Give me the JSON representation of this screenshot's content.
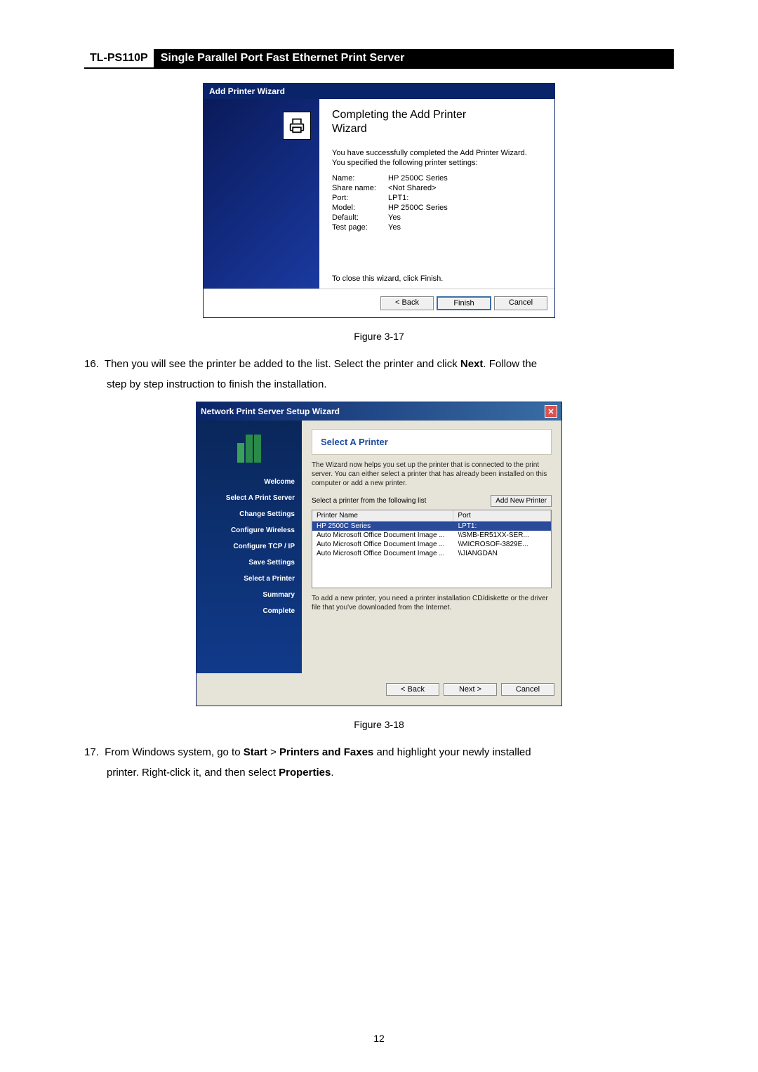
{
  "header": {
    "model": "TL-PS110P",
    "product": "Single Parallel Port Fast Ethernet Print Server"
  },
  "wizard1": {
    "title": "Add Printer Wizard",
    "heading1": "Completing the Add Printer",
    "heading2": "Wizard",
    "desc1": "You have successfully completed the Add Printer Wizard.",
    "desc2": "You specified the following printer settings:",
    "rows": {
      "name_k": "Name:",
      "name_v": "HP 2500C Series",
      "share_k": "Share name:",
      "share_v": "<Not Shared>",
      "port_k": "Port:",
      "port_v": "LPT1:",
      "model_k": "Model:",
      "model_v": "HP 2500C Series",
      "default_k": "Default:",
      "default_v": "Yes",
      "test_k": "Test page:",
      "test_v": "Yes"
    },
    "close_note": "To close this wizard, click Finish.",
    "back": "< Back",
    "finish": "Finish",
    "cancel": "Cancel"
  },
  "fig1": "Figure 3-17",
  "step16a": "16.  Then you will see the printer be added to the list. Select the printer and click ",
  "next_bold": "Next",
  "step16b": ". Follow the",
  "step16c": "step by step instruction to finish the installation.",
  "wizard2": {
    "title": "Network Print Server Setup Wizard",
    "side": {
      "i0": "Welcome",
      "i1": "Select A Print Server",
      "i2": "Change Settings",
      "i3": "Configure Wireless",
      "i4": "Configure TCP / IP",
      "i5": "Save Settings",
      "i6": "Select a Printer",
      "i7": "Summary",
      "i8": "Complete"
    },
    "panel_title": "Select A Printer",
    "desc": "The Wizard now helps you set up the printer that is connected to the print server. You can either select a printer that has already been installed on this computer or add a new printer.",
    "select_label": "Select a printer from the following list",
    "add_btn": "Add New Printer",
    "cols": {
      "c1": "Printer Name",
      "c2": "Port"
    },
    "rows": [
      {
        "name": "HP 2500C Series",
        "port": "LPT1:",
        "sel": true
      },
      {
        "name": "Auto Microsoft Office Document Image ...",
        "port": "\\\\SMB-ER51XX-SER..."
      },
      {
        "name": "Auto Microsoft Office Document Image ...",
        "port": "\\\\MICROSOF-3829E..."
      },
      {
        "name": "Auto Microsoft Office Document Image ...",
        "port": "\\\\JIANGDAN"
      }
    ],
    "note": "To add a new printer, you need a printer installation CD/diskette or the driver file that you've downloaded from the Internet.",
    "back": "< Back",
    "next": "Next >",
    "cancel": "Cancel"
  },
  "fig2": "Figure 3-18",
  "step17a": "17.  From Windows system, go to ",
  "start_b": "Start",
  "gt1": " > ",
  "printers_b": "Printers and Faxes",
  "step17b": " and highlight your newly installed",
  "step17c": "printer. Right-click it, and then select ",
  "props_b": "Properties",
  "step17d": ".",
  "page_num": "12"
}
